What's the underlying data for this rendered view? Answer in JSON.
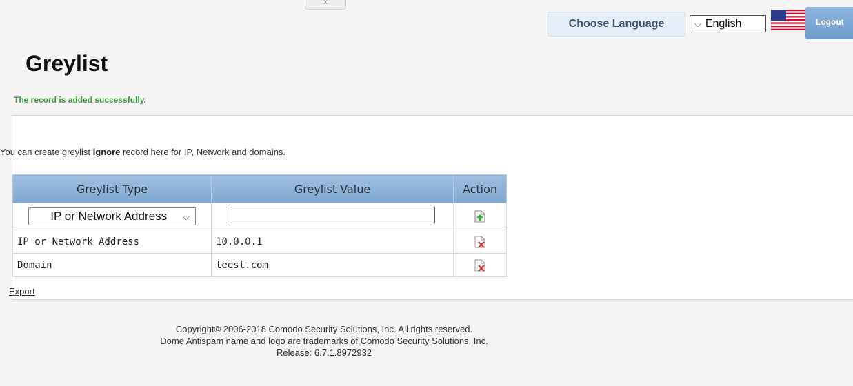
{
  "header": {
    "top_tab": "x",
    "choose_language": "Choose Language",
    "language_value": "English",
    "logout": "Logout"
  },
  "page": {
    "title": "Greylist",
    "success": "The record is added successfully.",
    "intro_before": "You can create greylist ",
    "intro_bold": "ignore",
    "intro_after": " record here for IP, Network and domains."
  },
  "table": {
    "headers": [
      "Greylist Type",
      "Greylist Value",
      "Action"
    ],
    "new_row": {
      "type_select": "IP or Network Address",
      "value_input": ""
    },
    "rows": [
      {
        "type": "IP or Network Address",
        "value": "10.0.0.1"
      },
      {
        "type": "Domain",
        "value": "teest.com"
      }
    ]
  },
  "export": "Export",
  "footer": {
    "line1": "Copyright© 2006-2018 Comodo Security Solutions, Inc. All rights reserved.",
    "line2": "Dome Antispam name and logo are trademarks of Comodo Security Solutions, Inc.",
    "line3": "Release: 6.7.1.8972932"
  },
  "colors": {
    "success": "#3c9a3c",
    "header_bg": "#8fb6df",
    "logout_bg": "#7ea6cf"
  },
  "icons": {
    "add": "add-record-icon",
    "delete": "delete-record-icon",
    "flag": "us-flag-icon"
  }
}
